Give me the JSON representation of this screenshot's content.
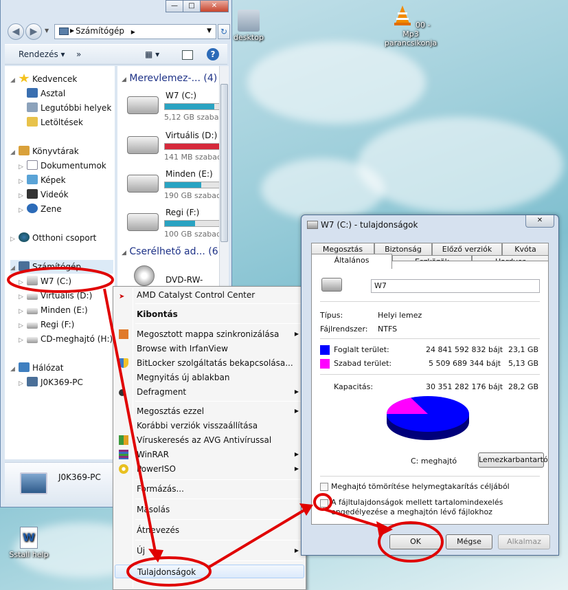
{
  "desktop": {
    "icons": [
      {
        "label": "desktop"
      },
      {
        "label": "00 - Mp3 parancsikonja"
      },
      {
        "label": "Sstall help"
      }
    ]
  },
  "explorer": {
    "address": "Számítógép",
    "toolbar": {
      "organize": "Rendezés",
      "more": "»"
    },
    "nav": {
      "favorites": "Kedvencek",
      "desktop": "Asztal",
      "recent": "Legutóbbi helyek",
      "downloads": "Letöltések",
      "libraries": "Könyvtárak",
      "documents": "Dokumentumok",
      "pictures": "Képek",
      "videos": "Videók",
      "music": "Zene",
      "homegroup": "Otthoni csoport",
      "computer": "Számítógép",
      "drives": [
        "W7 (C:)",
        "Virtuális (D:)",
        "Minden (E:)",
        "Regi (F:)",
        "CD-meghajtó (H:)"
      ],
      "network": "Hálózat",
      "pc": "J0K369-PC"
    },
    "content": {
      "hdd_group": "Merevlemez-... (4)",
      "removable_group": "Cserélhető ad... (6)",
      "drives": [
        {
          "name": "W7 (C:)",
          "free": "5,12 GB szabad",
          "used_fraction": 0.82,
          "color": "#29a3c2"
        },
        {
          "name": "Virtuális (D:)",
          "free": "141 MB szabad",
          "used_fraction": 0.97,
          "color": "#d6293b"
        },
        {
          "name": "Minden (E:)",
          "free": "190 GB szabad,",
          "used_fraction": 0.6,
          "color": "#29a3c2"
        },
        {
          "name": "Regi (F:)",
          "free": "100 GB szabad,",
          "used_fraction": 0.5,
          "color": "#29a3c2"
        }
      ],
      "dvd": "DVD-RW-meg"
    },
    "details_name": "J0K369-PC"
  },
  "context_menu": {
    "items": [
      "AMD Catalyst Control Center",
      "Kibontás",
      "Megosztott mappa szinkronizálása",
      "Browse with IrfanView",
      "BitLocker szolgáltatás bekapcsolása...",
      "Megnyitás új ablakban",
      "Defragment",
      "Megosztás ezzel",
      "Korábbi verziók visszaállítása",
      "Víruskeresés az AVG Antivírussal",
      "WinRAR",
      "PowerISO",
      "Formázás...",
      "Másolás",
      "Átnevezés",
      "Új",
      "Tulajdonságok"
    ]
  },
  "properties": {
    "title": "W7 (C:) - tulajdonságok",
    "tabs_row1": [
      "Megosztás",
      "Biztonság",
      "Előző verziók",
      "Kvóta"
    ],
    "tabs_row2": [
      "Általános",
      "Eszközök",
      "Hardver"
    ],
    "name": "W7",
    "type_label": "Típus:",
    "type_value": "Helyi lemez",
    "fs_label": "Fájlrendszer:",
    "fs_value": "NTFS",
    "used_label": "Foglalt terület:",
    "used_bytes": "24 841 592 832 bájt",
    "used_gb": "23,1 GB",
    "free_label": "Szabad terület:",
    "free_bytes": "5 509 689 344 bájt",
    "free_gb": "5,13 GB",
    "cap_label": "Kapacitás:",
    "cap_bytes": "30 351 282 176 bájt",
    "cap_gb": "28,2 GB",
    "drive_label": "C: meghajtó",
    "cleanup_btn": "Lemezkarbantartó",
    "compress_label": "Meghajtó tömörítése helymegtakarítás céljából",
    "index_label": "A fájltulajdonságok mellett tartalomindexelés engedélyezése a meghajtón lévő fájlokhoz",
    "ok": "OK",
    "cancel": "Mégse",
    "apply": "Alkalmaz",
    "used_color": "#0000ff",
    "free_color": "#ff00ff",
    "used_fraction": 0.818
  }
}
